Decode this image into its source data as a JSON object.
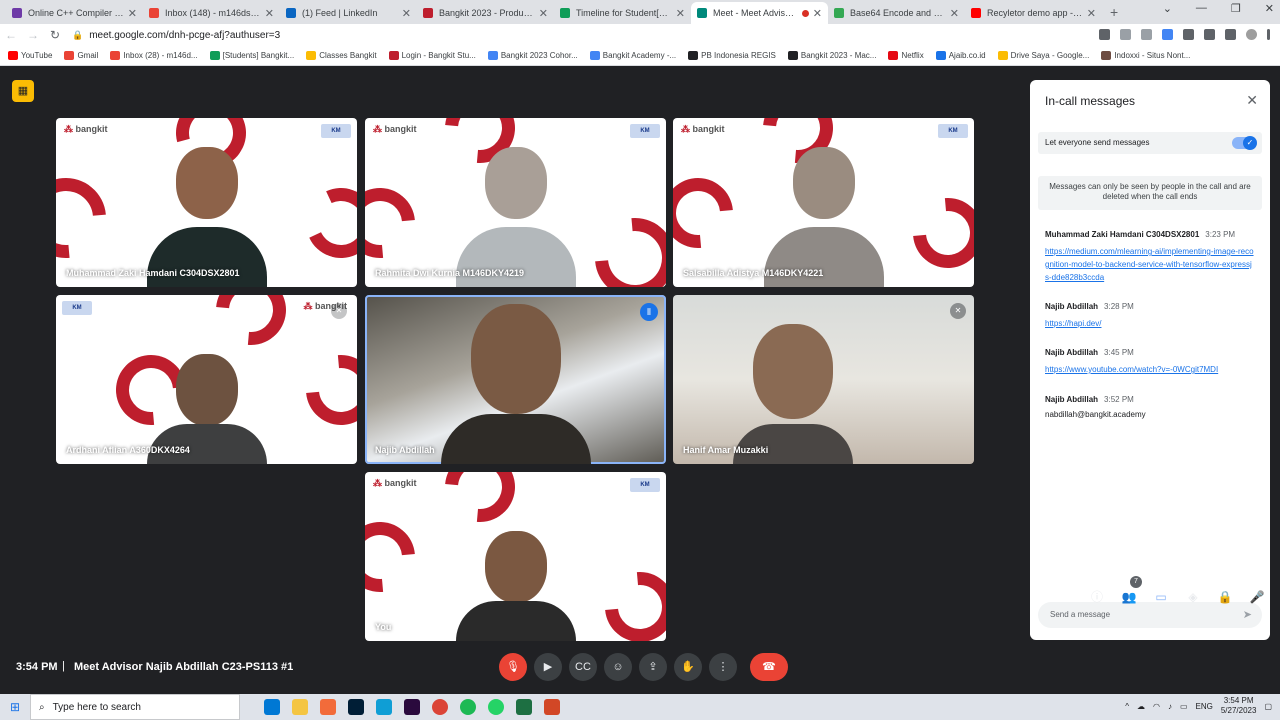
{
  "browser": {
    "tabs": [
      {
        "title": "Online C++ Compiler - onl",
        "color": "#6e3aa7"
      },
      {
        "title": "Inbox (148) - m146dsx2340",
        "color": "#ea4335"
      },
      {
        "title": "(1) Feed | LinkedIn",
        "color": "#0a66c2"
      },
      {
        "title": "Bangkit 2023 - Product-Ba",
        "color": "#be1e2d"
      },
      {
        "title": "Timeline for Student[Prod",
        "color": "#0f9d58"
      },
      {
        "title": "Meet - Meet Advisor N",
        "color": "#00897b"
      },
      {
        "title": "Base64 Encode and Decod",
        "color": "#34a853"
      },
      {
        "title": "Recyletor demo app - You",
        "color": "#ff0000"
      }
    ],
    "url": "meet.google.com/dnh-pcge-afj?authuser=3",
    "bookmarks": [
      {
        "label": "YouTube",
        "color": "#ff0000"
      },
      {
        "label": "Gmail",
        "color": "#ea4335"
      },
      {
        "label": "Inbox (28) - m146d...",
        "color": "#ea4335"
      },
      {
        "label": "[Students] Bangkit...",
        "color": "#0f9d58"
      },
      {
        "label": "Classes Bangkit",
        "color": "#fbbc04"
      },
      {
        "label": "Login - Bangkit Stu...",
        "color": "#be1e2d"
      },
      {
        "label": "Bangkit 2023 Cohor...",
        "color": "#4285f4"
      },
      {
        "label": "Bangkit Academy -...",
        "color": "#4285f4"
      },
      {
        "label": "PB Indonesia REGIS",
        "color": "#202124"
      },
      {
        "label": "Bangkit 2023 - Mac...",
        "color": "#202124"
      },
      {
        "label": "Netflix",
        "color": "#e50914"
      },
      {
        "label": "Ajaib.co.id",
        "color": "#1a73e8"
      },
      {
        "label": "Drive Saya - Google...",
        "color": "#fbbc04"
      },
      {
        "label": "Indoxxi - Situs Nont...",
        "color": "#6d4c41"
      }
    ]
  },
  "tiles": [
    {
      "name": "Muhammad Zaki Hamdani C304DSX2801"
    },
    {
      "name": "Rahmita Dwi Kurnia M146DKY4219"
    },
    {
      "name": "Salsabilla Adistya M146DKY4221"
    },
    {
      "name": "Ardhani Aflian A360DKX4264"
    },
    {
      "name": "Najib Abdillah"
    },
    {
      "name": "Hanif Amar Muzakki"
    },
    {
      "name": "You"
    }
  ],
  "bottom": {
    "time": "3:54 PM",
    "separator": "|",
    "meeting": "Meet Advisor Najib Abdillah C23-PS113 #1",
    "people_count": "7"
  },
  "panel": {
    "title": "In-call messages",
    "toggle_label": "Let everyone send messages",
    "notice": "Messages can only be seen by people in the call and are deleted when the call ends",
    "messages": [
      {
        "sender": "Muhammad Zaki Hamdani C304DSX2801",
        "time": "3:23 PM",
        "body": "https://medium.com/mlearning-ai/implementing-image-recognition-model-to-backend-service-with-tensorflow-expressjs-dde828b3ccda"
      },
      {
        "sender": "Najib Abdillah",
        "time": "3:28 PM",
        "body": "https://hapi.dev/"
      },
      {
        "sender": "Najib Abdillah",
        "time": "3:45 PM",
        "body": "https://www.youtube.com/watch?v=-0WCgit7MDI"
      },
      {
        "sender": "Najib Abdillah",
        "time": "3:52 PM",
        "body": "nabdillah@bangkit.academy"
      }
    ],
    "input_placeholder": "Send a message"
  },
  "taskbar": {
    "search_placeholder": "Type here to search",
    "lang": "ENG",
    "time": "3:54 PM",
    "date": "5/27/2023"
  }
}
